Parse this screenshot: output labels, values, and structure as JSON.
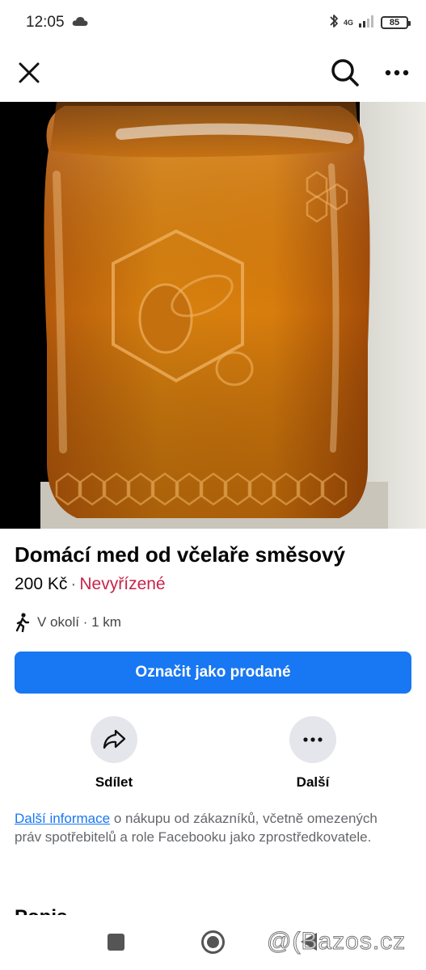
{
  "status_bar": {
    "time": "12:05",
    "network": "4G",
    "battery": "85",
    "icons": [
      "cloud-icon",
      "bluetooth-icon",
      "signal-icon",
      "battery-icon"
    ]
  },
  "top_bar": {
    "icons": [
      "close-icon",
      "search-icon",
      "more-icon"
    ]
  },
  "photo": {
    "icon": "honey-jar-photo"
  },
  "listing": {
    "title": "Domácí med od včelaře směsový",
    "price": "200 Kč",
    "separator": "·",
    "status": "Nevyřízené",
    "location": "V okolí · 1 km",
    "location_icon": "walking-person-icon"
  },
  "primary_action": {
    "label": "Označit jako prodané"
  },
  "actions": {
    "share_label": "Sdílet",
    "more_label": "Další",
    "share_icon": "share-arrow-icon",
    "more_icon": "more-icon"
  },
  "info": {
    "link": "Další informace",
    "text": " o nákupu od zákazníků, včetně omezených práv spotřebitelů a role Facebooku jako zprostředkovatele."
  },
  "description": {
    "heading": "Popis"
  },
  "watermark": "@(Bazos.cz",
  "colors": {
    "primary": "#1877f2",
    "status": "#c8244a",
    "secondary_text": "#65676b",
    "button_bg": "#e4e6eb"
  }
}
